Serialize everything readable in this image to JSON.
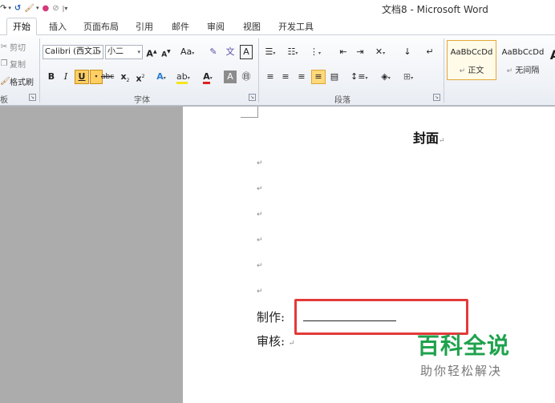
{
  "window": {
    "title": "文档8 - Microsoft Word"
  },
  "tabs": [
    {
      "label": "开始",
      "active": true
    },
    {
      "label": "插入"
    },
    {
      "label": "页面布局"
    },
    {
      "label": "引用"
    },
    {
      "label": "邮件"
    },
    {
      "label": "审阅"
    },
    {
      "label": "视图"
    },
    {
      "label": "开发工具"
    }
  ],
  "clipboard": {
    "cut": "剪切",
    "copy": "复制",
    "format_painter": "格式刷",
    "group_label": "板"
  },
  "font": {
    "name": "Calibri (西文正",
    "size": "小二",
    "case_label": "Aa",
    "group_label": "字体"
  },
  "paragraph": {
    "group_label": "段落"
  },
  "styles": [
    {
      "sample": "AaBbCcDd",
      "name": "正文",
      "selected": true
    },
    {
      "sample": "AaBbCcDd",
      "name": "无间隔",
      "selected": false
    }
  ],
  "document": {
    "title": "封面",
    "line_made_by": "制作:",
    "line_reviewed_by": "审核:",
    "paragraph_mark": "↵"
  },
  "watermark": {
    "title": "百科全说",
    "subtitle": "助你轻松解决"
  },
  "colors": {
    "highlight_box": "#e33a3a",
    "watermark_green": "#1ea24c",
    "selected_style_border": "#e3a83a"
  }
}
